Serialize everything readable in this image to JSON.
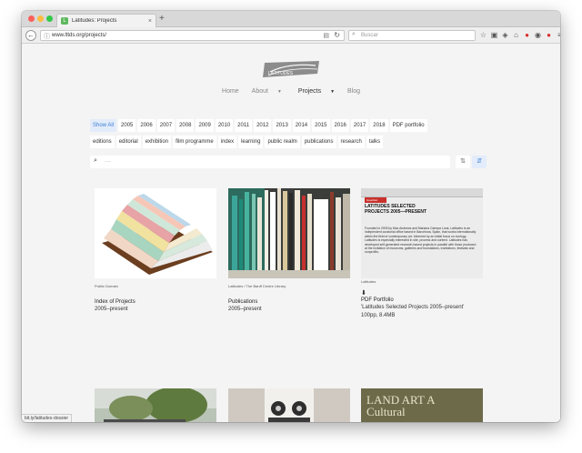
{
  "browser": {
    "tab_title": "Latitudes: Projects",
    "favicon_letter": "L",
    "tab_close": "×",
    "new_tab": "+",
    "back": "←",
    "url": "www.lttds.org/projects/",
    "search_placeholder": "Buscar",
    "status_url": "bit.ly/latitudes-dossier"
  },
  "site": {
    "logo_text": "LATITUDES",
    "nav": [
      {
        "label": "Home"
      },
      {
        "label": "About"
      },
      {
        "label": "Projects"
      },
      {
        "label": "Blog"
      }
    ]
  },
  "filters": {
    "years": [
      "Show All",
      "2005",
      "2006",
      "2007",
      "2008",
      "2009",
      "2010",
      "2011",
      "2012",
      "2013",
      "2014",
      "2015",
      "2016",
      "2017",
      "2018",
      "PDF portfolio"
    ],
    "categories": [
      "editions",
      "editorial",
      "exhibition",
      "film programme",
      "index",
      "learning",
      "public realm",
      "publications",
      "research",
      "talks"
    ],
    "search_placeholder": "...."
  },
  "cards": [
    {
      "caption": "Public Domain",
      "title": "Index of Projects",
      "sub": "2005–present"
    },
    {
      "caption": "Latitudes / The Banff Centre Library",
      "title": "Publications",
      "sub": "2005–present"
    },
    {
      "caption": "Latitudes",
      "title": "PDF Portfolio",
      "sub": "'Latitudes Selected Projects 2005–present'",
      "sub2": "100pp, 8.4MB",
      "doc_header": "LATITUDES SELECTED PROJECTS 2005—PRESENT",
      "doc_badge": "Guardian",
      "doc_body": "Founded in 2005 by Max Andrews and Mariana Cánepa Luna, Latitudes is an independent curatorial office based in Barcelona, Spain, that works internationally within the field of contemporary art. Informed by an initial focus on ecology, Latitudes is especially interested in site, process and context. Latitudes has developed self-generated research-based projects in parallel with those produced at the invitation of museums, galleries and foundations, institutions, festivals and nonprofits."
    }
  ],
  "bottom_cards": [
    {
      "art_text": "LAND ART A Cultural"
    }
  ],
  "colors": {
    "accent": "#3a7fd5",
    "accent_bg": "#e3ecfa",
    "page_bg": "#f4f4f4"
  }
}
